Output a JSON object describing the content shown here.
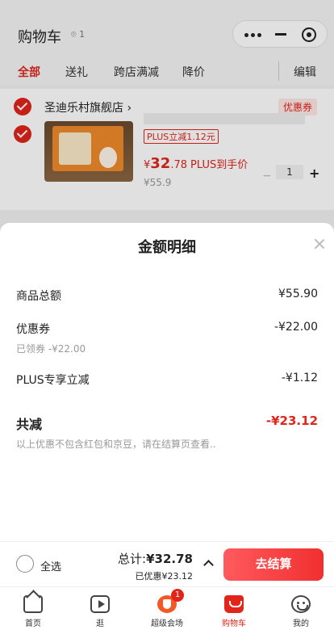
{
  "header": {
    "title": "购物车",
    "location_count": "1"
  },
  "tabs": [
    {
      "label": "全部"
    },
    {
      "label": "送礼"
    },
    {
      "label": "跨店满减"
    },
    {
      "label": "降价"
    }
  ],
  "edit_label": "编辑",
  "cart": {
    "shop_name": "圣迪乐村旗舰店",
    "coupon_tag": "优惠券",
    "item": {
      "plus_tag": "PLUS立减1.12元",
      "price_currency": "¥",
      "price_int": "32",
      "price_dec": ".78",
      "plus_price_text": "PLUS到手价",
      "original_price": "¥55.9",
      "quantity": "1"
    }
  },
  "sheet": {
    "title": "金额明细",
    "rows": [
      {
        "label": "商品总额",
        "value": "¥55.90"
      },
      {
        "label": "优惠券",
        "value": "-¥22.00",
        "sub": "已领券 -¥22.00"
      },
      {
        "label": "PLUS专享立减",
        "value": "-¥1.12"
      }
    ],
    "total_label": "共减",
    "total_value": "-¥23.12",
    "note": "以上优惠不包含红包和京豆，请在结算页查看.."
  },
  "checkout": {
    "select_all": "全选",
    "sum_label": "总计:",
    "sum_value": "¥32.78",
    "discount": "已优惠¥23.12",
    "button": "去结算"
  },
  "tabbar": {
    "items": [
      {
        "label": "首页",
        "icon": "home-icon"
      },
      {
        "label": "逛",
        "icon": "video-icon"
      },
      {
        "label": "超级会场",
        "icon": "venue-icon",
        "badge": "1"
      },
      {
        "label": "购物车",
        "icon": "cart-icon"
      },
      {
        "label": "我的",
        "icon": "face-icon"
      }
    ],
    "active": "购物车"
  },
  "colors": {
    "accent": "#e1251b",
    "checkout_gradient_start": "#ff5a5f",
    "checkout_gradient_end": "#f12f2f"
  }
}
